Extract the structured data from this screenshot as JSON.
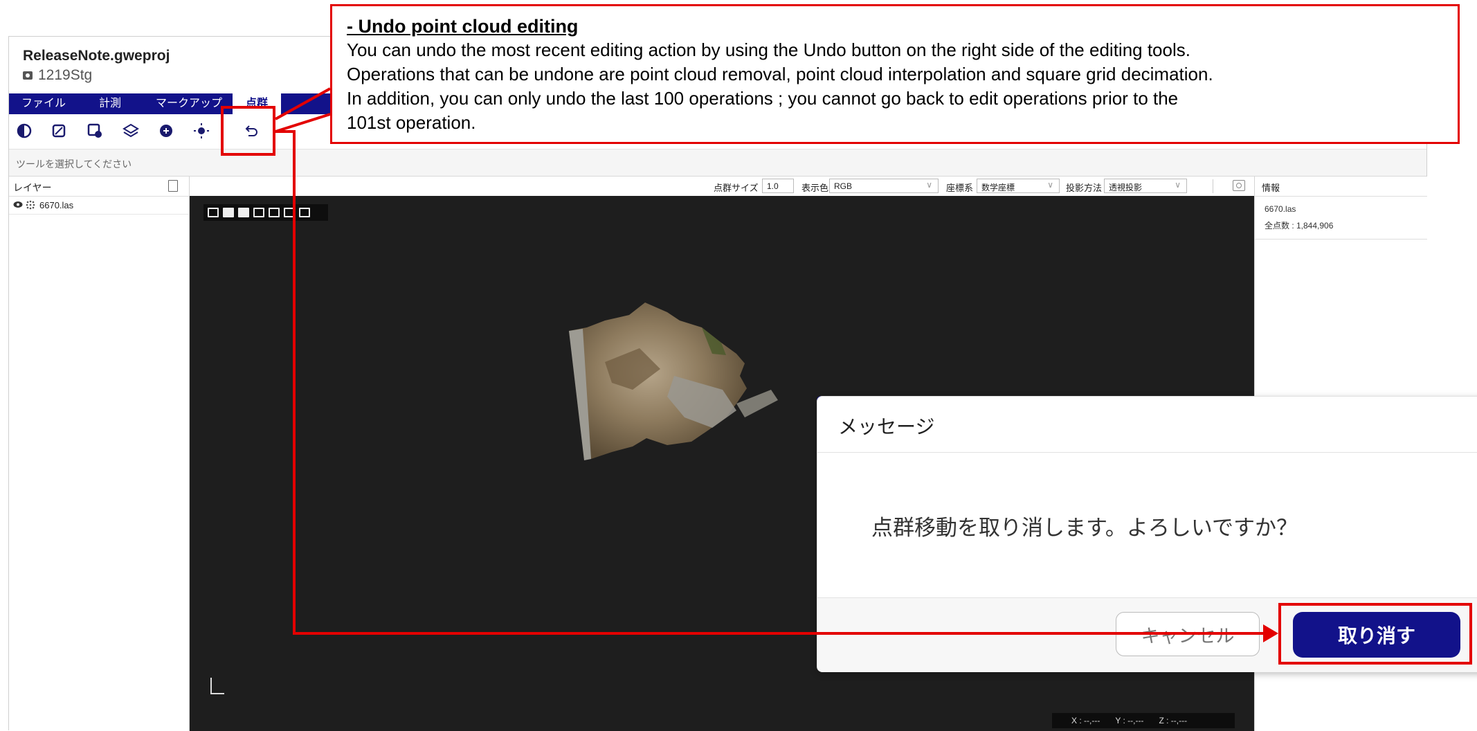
{
  "app": {
    "project_title": "ReleaseNote.gweproj",
    "stage_name": "1219Stg",
    "menu": [
      "ファイル",
      "計測",
      "マークアップ",
      "点群"
    ],
    "hint": "ツールを選択してください",
    "undo_glyph": "↶"
  },
  "layers": {
    "title": "レイヤー",
    "items": [
      {
        "name": "6670.las"
      }
    ]
  },
  "viewport": {
    "point_size_label": "点群サイズ",
    "point_size_value": "1.0",
    "display_color_label": "表示色",
    "display_color_value": "RGB",
    "coord_system_label": "座標系",
    "coord_system_value": "数学座標",
    "projection_label": "投影方法",
    "projection_value": "透視投影",
    "coords": {
      "x": "X : --,---",
      "y": "Y : --,---",
      "z": "Z : --,---"
    }
  },
  "info": {
    "title": "情報",
    "file": "6670.las",
    "total_points": "全点数 : 1,844,906"
  },
  "dialog": {
    "title": "メッセージ",
    "message": "点群移動を取り消します。よろしいですか？",
    "cancel_label": "キャンセル",
    "confirm_label": "取り消す"
  },
  "annotation": {
    "title": "- Undo point cloud editing",
    "lines": [
      "You can undo the most recent editing action by using the Undo button on the right side of the editing tools.",
      "Operations that can be undone are point cloud removal, point cloud interpolation and square grid decimation.",
      "In addition, you can only undo the last 100 operations ; you cannot go back to edit operations prior to the",
      "101st operation."
    ]
  },
  "colors": {
    "accent": "#12128a",
    "highlight": "#e30000"
  }
}
